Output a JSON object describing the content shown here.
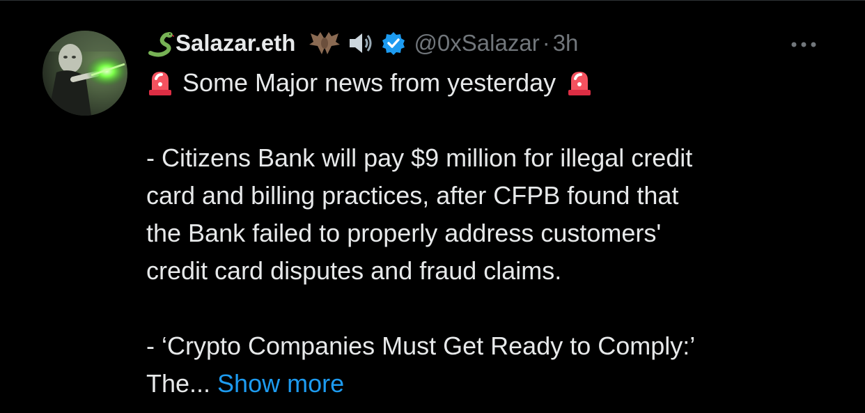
{
  "tweet": {
    "author": {
      "display_name": "Salazar.eth",
      "handle": "@0xSalazar",
      "verified": true,
      "name_emojis": [
        "snake-emoji",
        "bat-emoji",
        "speaker-emoji"
      ],
      "badge_icon": "verified-badge-icon",
      "badge_color": "#1d9bf0"
    },
    "separator": "·",
    "timestamp": "3h",
    "more_icon": "more-horizontal-icon",
    "headline": "Some Major news from yesterday",
    "headline_emoji": "rotating-light-emoji",
    "body_lines": [
      "- Citizens Bank will pay $9 million for illegal credit",
      "card and billing practices, after CFPB found that",
      "the Bank failed to properly address customers'",
      "credit card disputes and fraud claims."
    ],
    "body_lines_2": [
      "- ‘Crypto Companies Must Get Ready to Comply:’"
    ],
    "truncated_line": "The...",
    "show_more_label": "Show more"
  },
  "colors": {
    "background": "#000000",
    "text_primary": "#e7e9ea",
    "text_secondary": "#71767b",
    "link": "#1d9bf0",
    "divider": "#2f3336"
  }
}
